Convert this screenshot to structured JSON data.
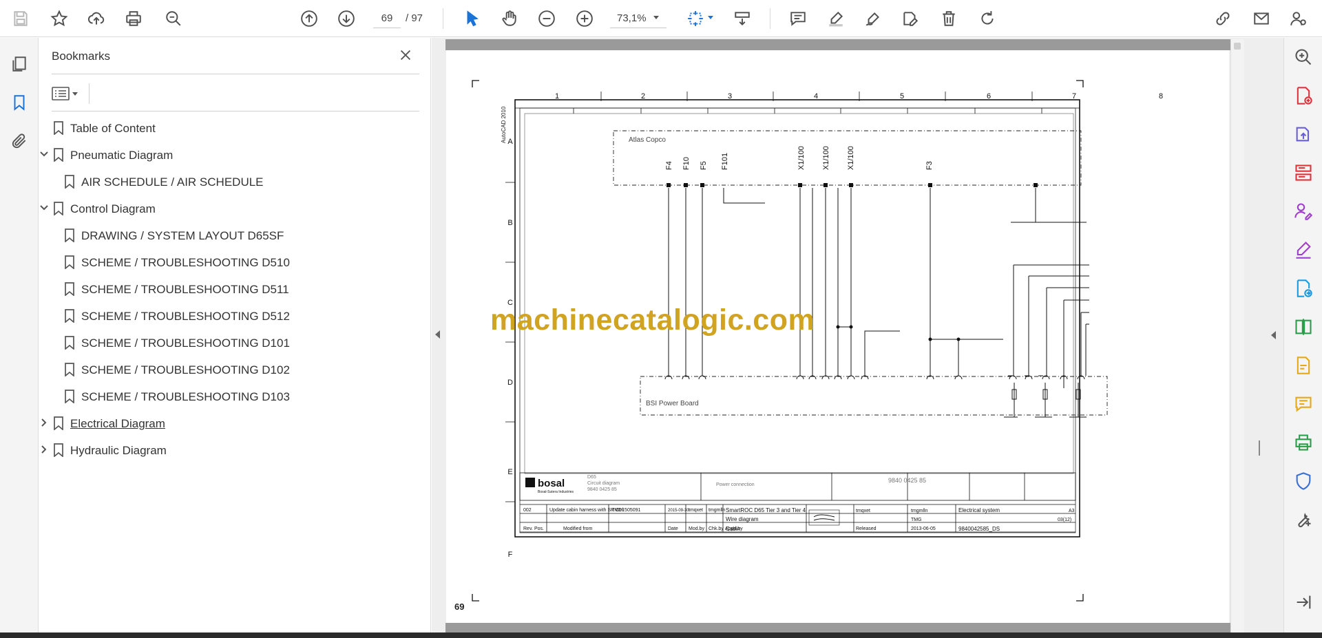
{
  "toolbar": {
    "current_page": "69",
    "total_pages": "/ 97",
    "zoom": "73,1%"
  },
  "bookmarks": {
    "title": "Bookmarks",
    "items": [
      {
        "label": "Table of Content",
        "level": 0,
        "chevron": "none"
      },
      {
        "label": "Pneumatic Diagram",
        "level": 0,
        "chevron": "expanded"
      },
      {
        "label": "AIR SCHEDULE / AIR SCHEDULE",
        "level": 1,
        "chevron": "none"
      },
      {
        "label": "Control Diagram",
        "level": 0,
        "chevron": "expanded"
      },
      {
        "label": "DRAWING / SYSTEM LAYOUT D65SF",
        "level": 1,
        "chevron": "none"
      },
      {
        "label": "SCHEME / TROUBLESHOOTING D510",
        "level": 1,
        "chevron": "none"
      },
      {
        "label": "SCHEME / TROUBLESHOOTING D511",
        "level": 1,
        "chevron": "none"
      },
      {
        "label": "SCHEME / TROUBLESHOOTING D512",
        "level": 1,
        "chevron": "none"
      },
      {
        "label": "SCHEME / TROUBLESHOOTING D101",
        "level": 1,
        "chevron": "none"
      },
      {
        "label": "SCHEME / TROUBLESHOOTING D102",
        "level": 1,
        "chevron": "none"
      },
      {
        "label": "SCHEME / TROUBLESHOOTING D103",
        "level": 1,
        "chevron": "none"
      },
      {
        "label": "Electrical Diagram",
        "level": 0,
        "chevron": "collapsed"
      },
      {
        "label": "Hydraulic Diagram",
        "level": 0,
        "chevron": "collapsed"
      }
    ]
  },
  "document": {
    "page_label": "69",
    "watermark": "machinecatalogic.com",
    "drawing": {
      "columns": [
        "1",
        "2",
        "3",
        "4",
        "5",
        "6",
        "7",
        "8"
      ],
      "rows": [
        "A",
        "B",
        "C",
        "D",
        "E",
        "F"
      ],
      "side_text": "AutoCAD 2010",
      "box_top_label": "Atlas Copco",
      "box_bottom_label": "BSI Power Board",
      "signals": [
        "F4",
        "F10",
        "F5",
        "F101",
        "X1/100",
        "X1/100",
        "X1/100",
        "F3"
      ],
      "title_block": {
        "project": "SmartROC D65 Tier 3 and Tier 4",
        "description": "Wire diagram",
        "subtitle": "Cabin",
        "drawing_no": "9840 0425 85",
        "designation": "Electrical system",
        "doc_id": "9840042585_DS",
        "sheet": "03(12)",
        "size": "A3",
        "revision": "002",
        "rev_note": "Update cabin harness with SR Ctrl",
        "rev_ref": "TMD1505091",
        "rev_date": "2015-09-30",
        "drawn_by": "tmqxet",
        "approved_by": "tmgmlln",
        "status": "Released",
        "date": "2013-06-05",
        "company": "TMG",
        "header_rev": "Rev.",
        "header_pos": "Pos.",
        "header_mod": "Modified from",
        "header_date": "Date",
        "header_modby": "Mod.by",
        "header_chk": "Chk.by",
        "header_appd": "Appd.by",
        "brand": "bosal",
        "brand_sub": "Bosal-Sutera Industries",
        "power_label": "Power connection",
        "d65_label": "D65",
        "d65_sub": "Circuit diagram",
        "small_drawing": "9840 0425 85"
      }
    }
  }
}
